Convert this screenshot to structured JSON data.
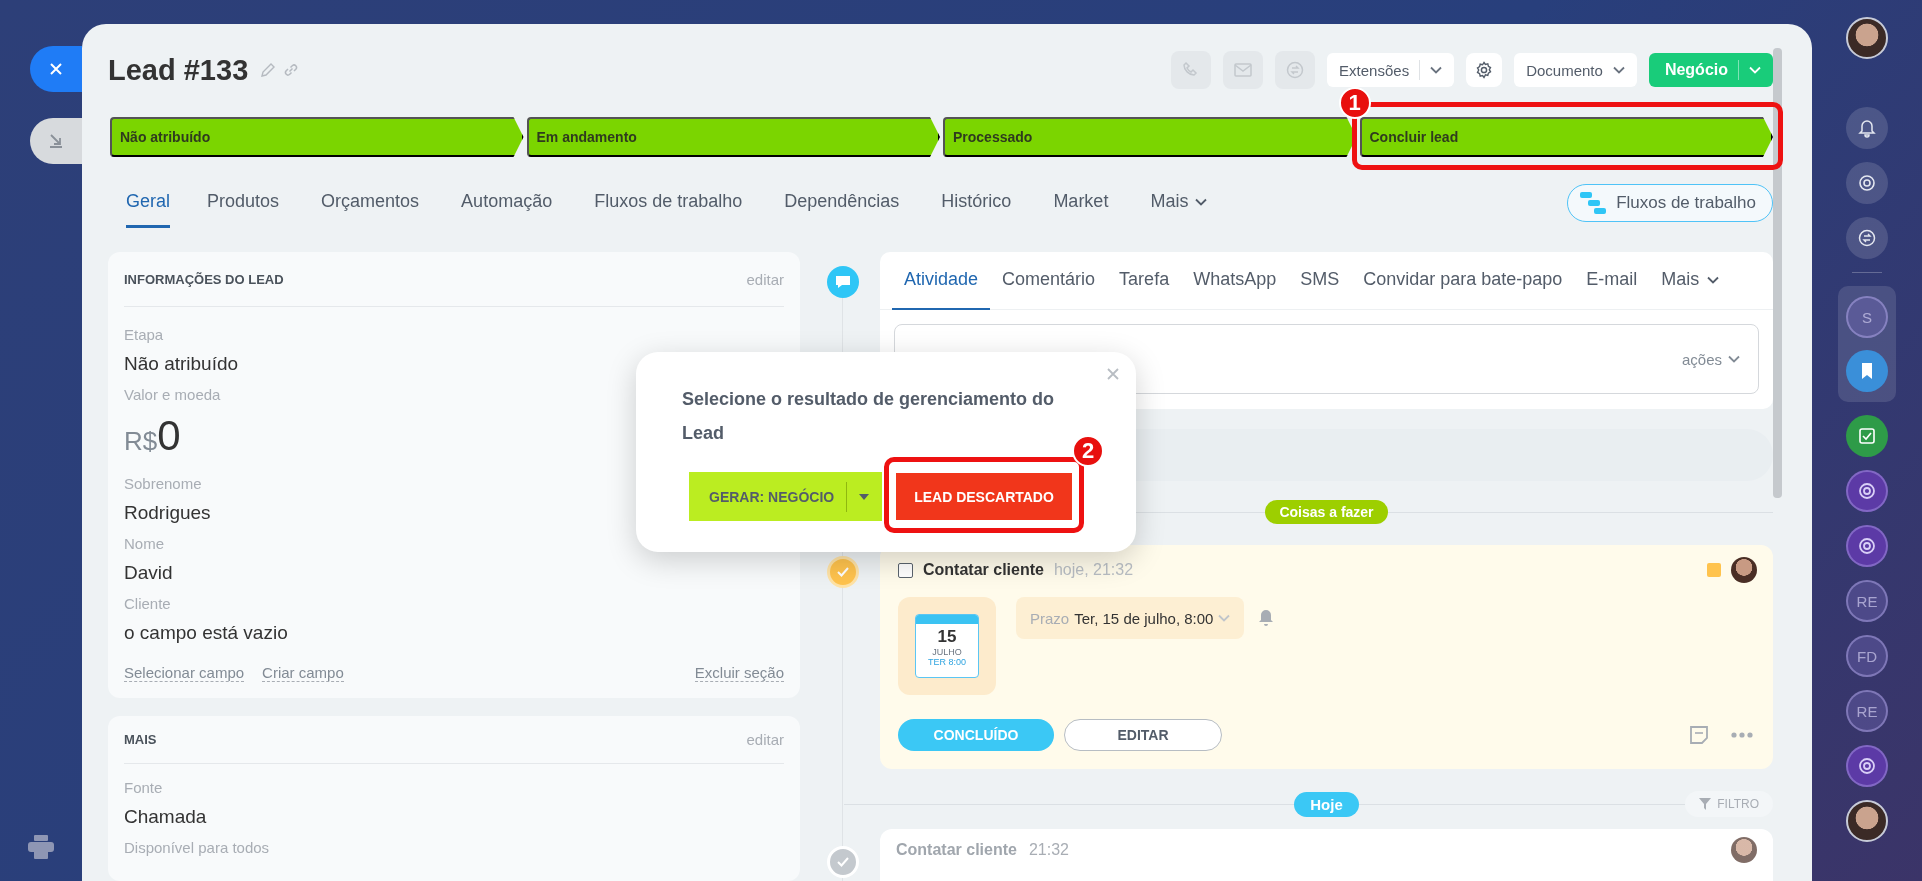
{
  "window": {
    "title": "Lead #133"
  },
  "header_actions": [
    {
      "kind": "phone",
      "disabled": true
    },
    {
      "kind": "mail",
      "disabled": true
    },
    {
      "kind": "chat",
      "disabled": true
    }
  ],
  "extensions_button": {
    "label": "Extensões"
  },
  "document_button": {
    "label": "Documento"
  },
  "primary_button": {
    "label": "Negócio"
  },
  "stages": [
    {
      "label": "Não atribuído"
    },
    {
      "label": "Em andamento"
    },
    {
      "label": "Processado"
    },
    {
      "label": "Concluir lead",
      "annotation": "1"
    }
  ],
  "tabs": [
    {
      "label": "Geral",
      "selected": true,
      "kind": "tab"
    },
    {
      "label": "Produtos",
      "selected": false,
      "kind": "tab"
    },
    {
      "label": "Orçamentos",
      "selected": false,
      "kind": "tab"
    },
    {
      "label": "Automação",
      "selected": false,
      "kind": "tab"
    },
    {
      "label": "Fluxos de trabalho",
      "selected": false,
      "kind": "tab"
    },
    {
      "label": "Dependências",
      "selected": false,
      "kind": "tab"
    },
    {
      "label": "Histórico",
      "selected": false,
      "kind": "tab"
    },
    {
      "label": "Market",
      "selected": false,
      "kind": "tab"
    },
    {
      "label": "Mais",
      "selected": false,
      "kind": "menu"
    }
  ],
  "workflow_button": {
    "label": "Fluxos de trabalho"
  },
  "lead_info": {
    "title": "INFORMAÇÕES DO LEAD",
    "edit_link": "editar",
    "fields": [
      {
        "kind": "text",
        "label": "Etapa",
        "value": "Não atribuído"
      },
      {
        "kind": "money",
        "label": "Valor e moeda",
        "currency": "R$",
        "value": "0"
      },
      {
        "kind": "text",
        "label": "Sobrenome",
        "value": "Rodrigues"
      },
      {
        "kind": "text",
        "label": "Nome",
        "value": "David"
      },
      {
        "kind": "text",
        "label": "Cliente",
        "value": "o campo está vazio"
      }
    ],
    "links": [
      "Selecionar campo",
      "Criar campo"
    ],
    "delete_link": "Excluir seção"
  },
  "more_section": {
    "title": "MAIS",
    "edit_link": "editar",
    "fields": [
      {
        "kind": "text",
        "label": "Fonte",
        "value": "Chamada"
      },
      {
        "kind": "label",
        "label": "Disponível para todos"
      }
    ]
  },
  "activity": {
    "tabs": [
      {
        "label": "Atividade",
        "selected": true,
        "kind": "tab"
      },
      {
        "label": "Comentário",
        "selected": false,
        "kind": "tab"
      },
      {
        "label": "Tarefa",
        "selected": false,
        "kind": "tab"
      },
      {
        "label": "WhatsApp",
        "selected": false,
        "kind": "tab"
      },
      {
        "label": "SMS",
        "selected": false,
        "kind": "tab"
      },
      {
        "label": "Convidar para bate-papo",
        "selected": false,
        "kind": "tab"
      },
      {
        "label": "E-mail",
        "selected": false,
        "kind": "tab"
      },
      {
        "label": "Mais",
        "selected": false,
        "kind": "menu"
      }
    ],
    "actions_label": "ações"
  },
  "popup": {
    "title": "Selecione o resultado de gerenciamento do Lead",
    "convert_button": "GERAR: NEGÓCIO",
    "reject_button": "LEAD DESCARTADO",
    "annotation": "2"
  },
  "timeline": {
    "todo_badge": "Coisas a fazer",
    "task": {
      "title": "Contatar cliente",
      "time": "hoje, 21:32",
      "checked": false,
      "calendar": {
        "day": "15",
        "month": "JULHO",
        "weekday_time": "TER 8:00"
      },
      "deadline_label": "Prazo",
      "deadline": "Ter, 15 de julho, 8:00",
      "done_button": "CONCLUÍDO",
      "edit_button": "EDITAR"
    },
    "today_badge": "Hoje",
    "filter": "FILTRO",
    "history": [
      {
        "title": "Contatar cliente",
        "time": "21:32"
      }
    ]
  },
  "sidebar": {
    "top": [
      {
        "kind": "photo"
      },
      {
        "kind": "bell"
      },
      {
        "kind": "copilot"
      },
      {
        "kind": "chat"
      }
    ],
    "pinned": [
      {
        "kind": "initials",
        "label": "S"
      },
      {
        "kind": "bookmark"
      }
    ],
    "apps": [
      {
        "kind": "tasks"
      },
      {
        "kind": "openline"
      },
      {
        "kind": "openline"
      },
      {
        "kind": "initials",
        "label": "RE"
      },
      {
        "kind": "initials",
        "label": "FD"
      },
      {
        "kind": "initials",
        "label": "RE"
      },
      {
        "kind": "openline"
      },
      {
        "kind": "photo"
      }
    ]
  }
}
